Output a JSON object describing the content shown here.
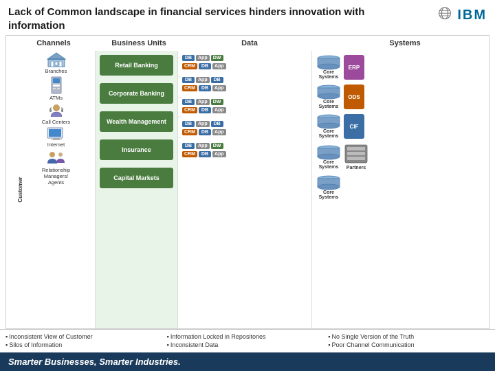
{
  "header": {
    "title": "Lack of Common landscape in financial services hinders innovation with information"
  },
  "ibm": {
    "logo_text": "IBM"
  },
  "columns": {
    "channels": "Channels",
    "business_units": "Business Units",
    "data": "Data",
    "systems": "Systems"
  },
  "channels": [
    {
      "icon": "🏦",
      "label": "Branches"
    },
    {
      "icon": "🏧",
      "label": "ATMs"
    },
    {
      "icon": "📞",
      "label": "Call Centers"
    },
    {
      "icon": "💻",
      "label": "Internet"
    },
    {
      "icon": "👤",
      "label": "Relationship Managers/ Agents"
    }
  ],
  "customer_label": "Customer",
  "business_units": [
    "Retail Banking",
    "Corporate Banking",
    "Wealth Management",
    "Insurance",
    "Capital Markets"
  ],
  "data_rows": [
    {
      "row1": [
        "DB",
        "App",
        "DW"
      ],
      "row2": [
        "CRM",
        "DB",
        "App"
      ]
    },
    {
      "row1": [
        "DB",
        "App",
        "DB"
      ],
      "row2": [
        "CRM",
        "DB",
        "App"
      ]
    },
    {
      "row1": [
        "DB",
        "App",
        "DW"
      ],
      "row2": [
        "CRM",
        "DB",
        "App"
      ]
    },
    {
      "row1": [
        "DB",
        "App",
        "DB"
      ],
      "row2": [
        "CRM",
        "DB",
        "App"
      ]
    },
    {
      "row1": [
        "DB",
        "App",
        "DW"
      ],
      "row2": [
        "CRM",
        "DB",
        "App"
      ]
    }
  ],
  "systems": [
    {
      "core": "Core Systems",
      "product": "ERP"
    },
    {
      "core": "Core Systems",
      "product": "ODS"
    },
    {
      "core": "Core Systems",
      "product": "CIF"
    },
    {
      "core": "Core Systems",
      "product": ""
    },
    {
      "core": "Core Systems",
      "product": "Partners"
    }
  ],
  "footer": {
    "col1": [
      "Inconsistent View of Customer",
      "Silos of Information"
    ],
    "col2": [
      "Information Locked in Repositories",
      "Inconsistent Data"
    ],
    "col3": [
      "No Single Version of the Truth",
      "Poor Channel Communication"
    ]
  },
  "bottom_bar": "Smarter Businesses, Smarter Industries."
}
